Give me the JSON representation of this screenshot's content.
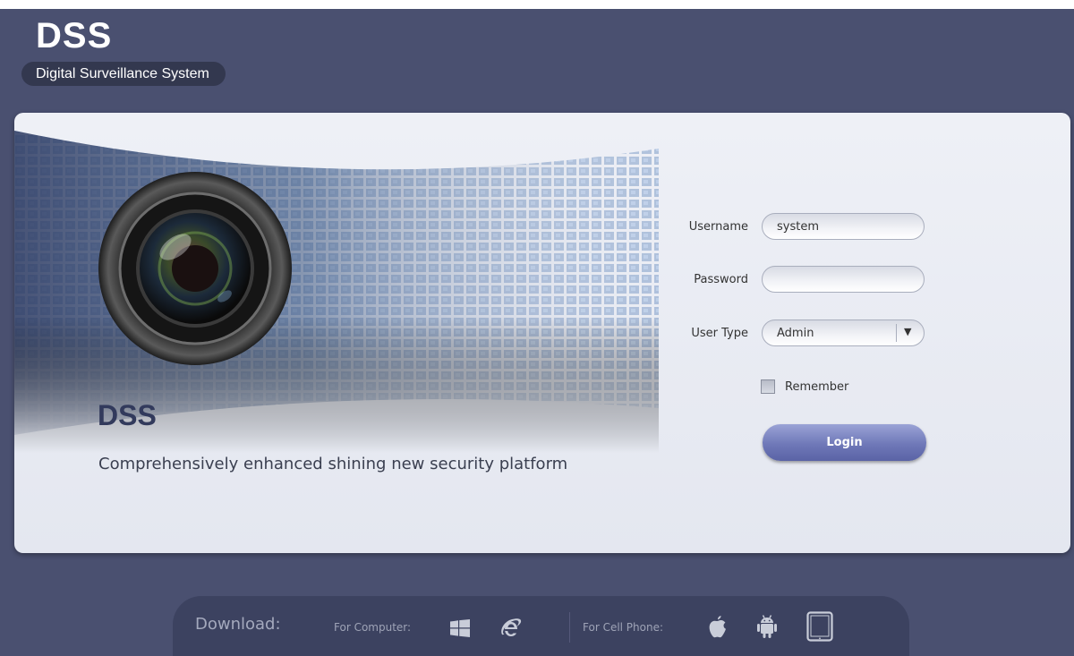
{
  "app": {
    "logo_title": "DSS",
    "logo_subtitle": "Digital Surveillance System"
  },
  "hero": {
    "title": "DSS",
    "subtitle": "Comprehensively enhanced shining new security platform"
  },
  "login_form": {
    "username_label": "Username",
    "username_value": "system",
    "password_label": "Password",
    "password_value": "",
    "user_type_label": "User Type",
    "user_type_value": "Admin",
    "remember_label": "Remember",
    "remember_checked": false,
    "login_button_label": "Login"
  },
  "download": {
    "title": "Download:",
    "computer_label": "For Computer:",
    "computer_icons": [
      "windows-icon",
      "internet-explorer-icon"
    ],
    "phone_label": "For Cell Phone:",
    "phone_icons": [
      "apple-icon",
      "android-icon",
      "tablet-icon"
    ]
  },
  "colors": {
    "background": "#4a5070",
    "panel": "#e8eaf1",
    "accent": "#6f78b8",
    "title_text": "#323a5c"
  }
}
